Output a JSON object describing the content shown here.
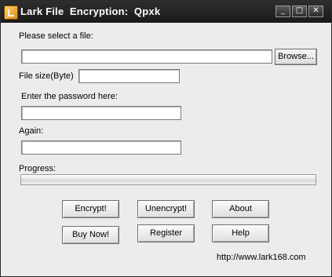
{
  "window": {
    "title": "Lark File  Encryption:  Qpxk",
    "controls": {
      "minimize": "_",
      "maximize": "□",
      "close": "✕"
    }
  },
  "form": {
    "select_file_label": "Please select a file:",
    "file_path_value": "",
    "browse_label": "Browse...",
    "file_size_label": "File size(Byte)",
    "file_size_value": "",
    "password_label": "Enter the password here:",
    "password_value": "",
    "again_label": "Again:",
    "again_value": "",
    "progress_label": "Progress:",
    "progress_fraction": 0
  },
  "buttons": {
    "encrypt": "Encrypt!",
    "unencrypt": "Unencrypt!",
    "about": "About",
    "buy_now": "Buy Now!",
    "register": "Register",
    "help": "Help"
  },
  "footer": {
    "url": "http://www.lark168.com"
  }
}
